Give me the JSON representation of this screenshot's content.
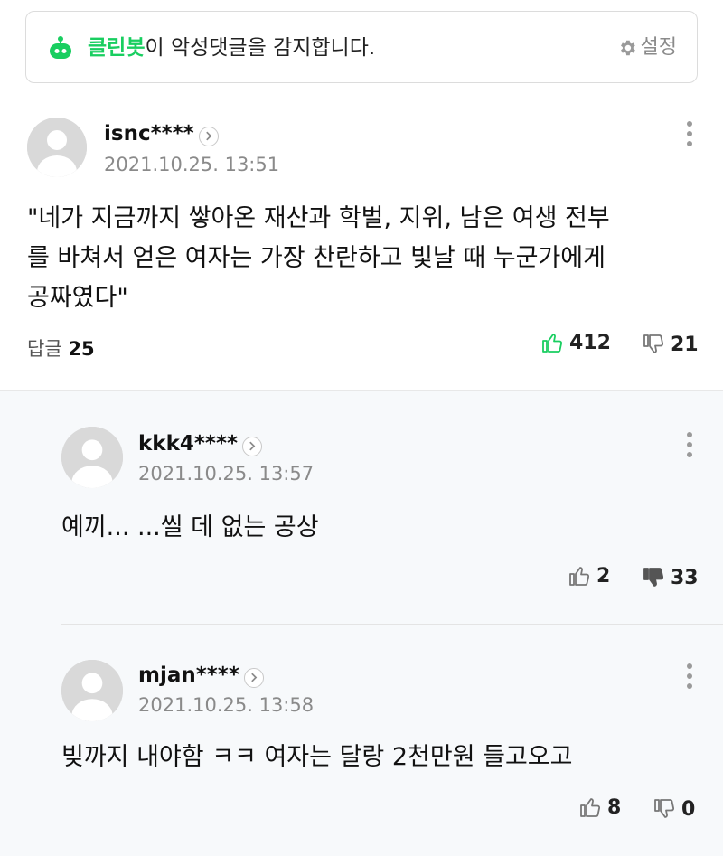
{
  "cleanbot": {
    "brand": "클린봇",
    "message": "이 악성댓글을 감지합니다.",
    "settings_label": "설정",
    "brand_color": "#19ce60"
  },
  "comments": [
    {
      "nickname": "isnc****",
      "date": "2021.10.25. 13:51",
      "text_lines": [
        "\"네가 지금까지 쌓아온 재산과 학벌, 지위, 남은 여생 전부",
        "를 바쳐서 얻은 여자는 가장 찬란하고 빛날 때 누군가에게",
        "공짜였다\""
      ],
      "reply_label": "답글",
      "reply_count": "25",
      "likes": "412",
      "dislikes": "21",
      "liked": true,
      "disliked": false
    },
    {
      "nickname": "kkk4****",
      "date": "2021.10.25. 13:57",
      "text_lines": [
        "예끼... ...씰 데 없는 공상"
      ],
      "likes": "2",
      "dislikes": "33",
      "liked": false,
      "disliked": true
    },
    {
      "nickname": "mjan****",
      "date": "2021.10.25. 13:58",
      "text_lines": [
        "빚까지 내야함 ㅋㅋ 여자는 달랑 2천만원 들고오고"
      ],
      "likes": "8",
      "dislikes": "0",
      "liked": false,
      "disliked": false
    }
  ],
  "icons": {
    "bot": "cleanbot-icon",
    "gear": "gear-icon",
    "arrow": "chevron-right-icon",
    "more": "more-vertical-icon",
    "like": "thumbs-up-icon",
    "dislike": "thumbs-down-icon"
  }
}
